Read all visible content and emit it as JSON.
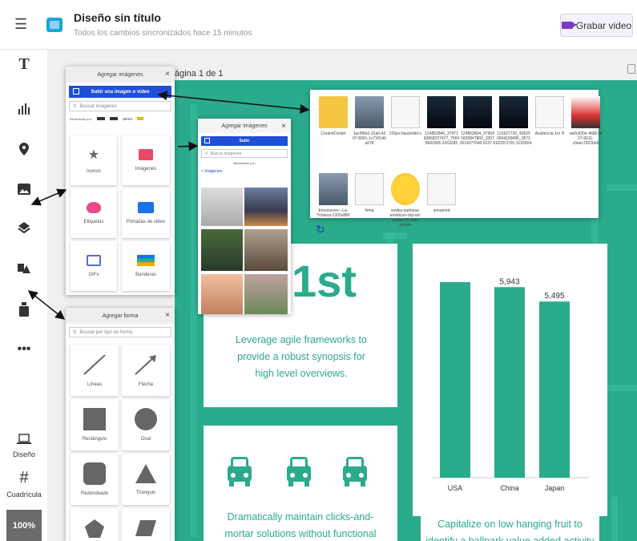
{
  "header": {
    "title": "Diseño sin título",
    "subtitle": "Todos los cambios sincronizados hace 15 minutos",
    "record_label": "Grabar video"
  },
  "sidebar": {
    "design_label": "Diseño",
    "grid_label": "Cuadrícula",
    "zoom": "100%"
  },
  "canvas": {
    "page_label": "ágina 1 de 1"
  },
  "images_panel": {
    "title": "Agregar imágenes",
    "upload_label": "Subir una imagen o video",
    "search_placeholder": "Buscar imágenes",
    "powered_label": "Alimentado por:",
    "tiles": [
      "Iconos",
      "Imágenes",
      "Etiquetas",
      "Portadas de video",
      "GIFs",
      "Banderas"
    ]
  },
  "images_panel_small": {
    "title": "Agregar imágenes",
    "upload_label": "Subir",
    "search_placeholder": "Buscar imágenes",
    "powered_label": "Alimentado por:",
    "back_label": "< Imágenes"
  },
  "shapes_panel": {
    "title": "Agregar forma",
    "search_placeholder": "Buscar por tipo de forma",
    "tiles": [
      "Líneas",
      "Flecha",
      "Rectángulo",
      "Oval",
      "Redondeado",
      "Triángulo"
    ]
  },
  "files": [
    {
      "name": "ControlCenter",
      "kind": "folder"
    },
    {
      "name": "1ac9f6b1-31a0-42 07-8301-1c718146 a078",
      "kind": "photo"
    },
    {
      "name": "220px-Nucleótid o",
      "kind": "doc"
    },
    {
      "name": "124852846_37971 92868237477_7664 8662805 2263282",
      "kind": "dark"
    },
    {
      "name": "124852804_37964 1820847802_3307 2624277040 6227 6",
      "kind": "dark"
    },
    {
      "name": "131627720_42625 0904158495_3572 6228 0791 3193004",
      "kind": "dark"
    },
    {
      "name": "Asistencia 1ro H",
      "kind": "doc"
    },
    {
      "name": "ee0c830e-4680-4f 27-9011-c0eec7822bb6",
      "kind": "car"
    },
    {
      "name": "Emociones---La-Tristeza-1305x880",
      "kind": "photo"
    },
    {
      "name": "firma",
      "kind": "doc"
    },
    {
      "name": "smiley-sadness-emoticon-clip-art-picture-of-sad-people",
      "kind": "emoji"
    },
    {
      "name": "unnamed",
      "kind": "doc"
    }
  ],
  "infographic": {
    "big_text": "1st",
    "card1_text": "Leverage agile frameworks to provide a robust synopsis for high level overviews.",
    "card3_text": "Dramatically maintain clicks-and-mortar solutions without functional solutions.",
    "card4_text": "Capitalize on low hanging fruit to identify a ballpark value added activity"
  },
  "chart_data": {
    "type": "bar",
    "categories": [
      "USA",
      "China",
      "Japan"
    ],
    "values": [
      null,
      5943,
      5495
    ],
    "value_labels": [
      "",
      "5,943",
      "5,495"
    ],
    "colors": [
      "#2aab8c"
    ]
  }
}
